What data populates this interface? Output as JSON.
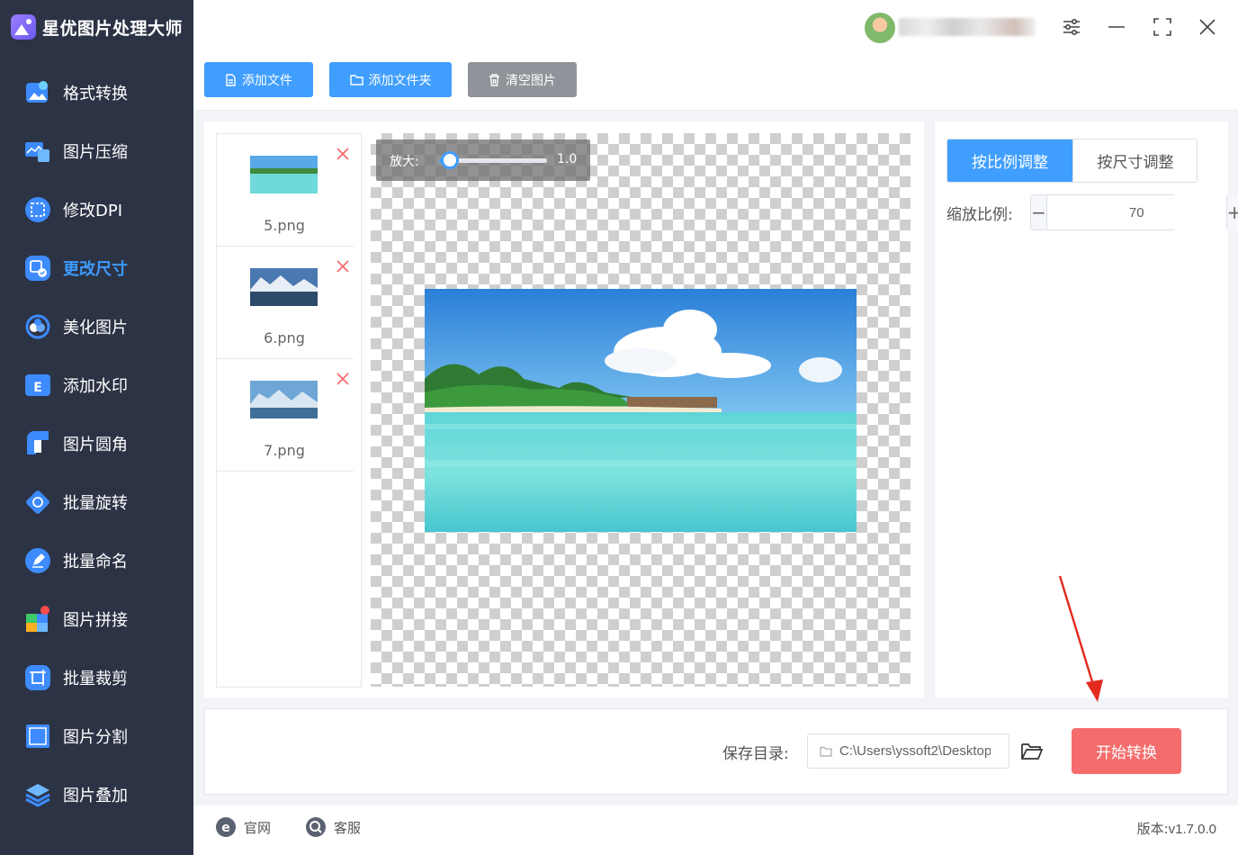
{
  "app": {
    "title": "星优图片处理大师"
  },
  "sidebar": {
    "items": [
      {
        "label": "格式转换",
        "icon": "image-convert-icon"
      },
      {
        "label": "图片压缩",
        "icon": "image-compress-icon"
      },
      {
        "label": "修改DPI",
        "icon": "dpi-icon"
      },
      {
        "label": "更改尺寸",
        "icon": "resize-icon",
        "active": true
      },
      {
        "label": "美化图片",
        "icon": "beautify-icon"
      },
      {
        "label": "添加水印",
        "icon": "watermark-icon"
      },
      {
        "label": "图片圆角",
        "icon": "rounded-corner-icon"
      },
      {
        "label": "批量旋转",
        "icon": "rotate-icon"
      },
      {
        "label": "批量命名",
        "icon": "rename-icon"
      },
      {
        "label": "图片拼接",
        "icon": "puzzle-icon"
      },
      {
        "label": "批量裁剪",
        "icon": "crop-icon"
      },
      {
        "label": "图片分割",
        "icon": "split-icon"
      },
      {
        "label": "图片叠加",
        "icon": "layers-icon"
      }
    ]
  },
  "toolbar": {
    "add_file": "添加文件",
    "add_folder": "添加文件夹",
    "clear": "清空图片"
  },
  "files": [
    {
      "name": "5.png"
    },
    {
      "name": "6.png"
    },
    {
      "name": "7.png"
    }
  ],
  "preview": {
    "zoom_label": "放大:",
    "zoom_value": "1.0",
    "zoom_level": 0.0
  },
  "settings": {
    "tab_ratio": "按比例调整",
    "tab_size": "按尺寸调整",
    "scale_label": "缩放比例:",
    "scale_value": "70"
  },
  "output": {
    "save_label": "保存目录:",
    "path": "C:\\Users\\yssoft2\\Desktop",
    "start": "开始转换"
  },
  "footer": {
    "website": "官网",
    "support": "客服",
    "version_label": "版本:",
    "version": "v1.7.0.0"
  },
  "colors": {
    "sidebar_bg": "#2c3345",
    "accent": "#409eff",
    "danger": "#f56c6c",
    "neutral_button": "#909399"
  }
}
